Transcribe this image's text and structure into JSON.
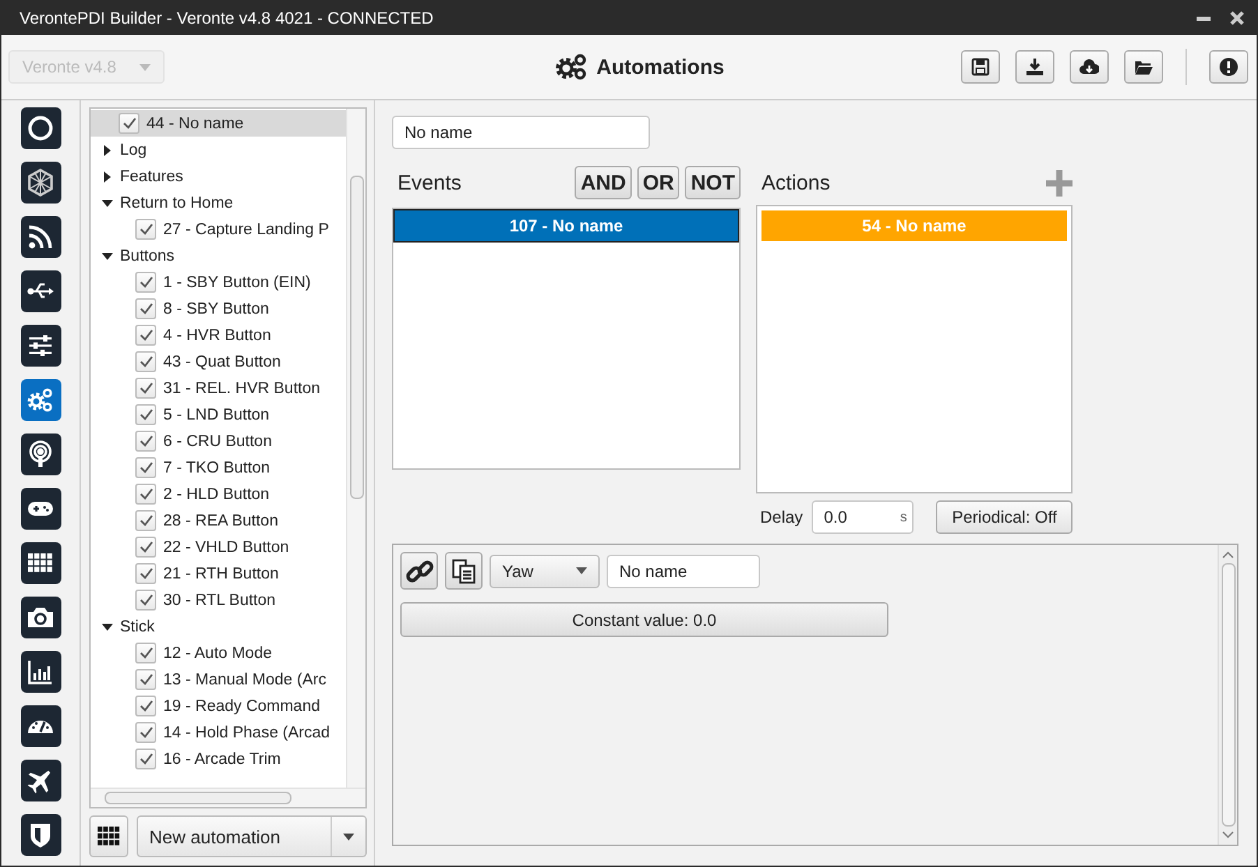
{
  "window": {
    "title": "VerontePDI Builder - Veronte v4.8 4021 - CONNECTED"
  },
  "toolbar": {
    "device": {
      "value": "Veronte v4.8",
      "disabled": true
    },
    "title": "Automations",
    "buttons": [
      {
        "kind": "save"
      },
      {
        "kind": "download"
      },
      {
        "kind": "cloud"
      },
      {
        "kind": "folder"
      },
      {
        "kind": "info"
      }
    ]
  },
  "sidebar": {
    "items": [
      {
        "kind": "ring",
        "selected": false
      },
      {
        "kind": "hex",
        "selected": false
      },
      {
        "kind": "rss",
        "selected": false
      },
      {
        "kind": "usb",
        "selected": false
      },
      {
        "kind": "sliders",
        "selected": false
      },
      {
        "kind": "gears",
        "selected": true
      },
      {
        "kind": "podcast",
        "selected": false
      },
      {
        "kind": "gamepad",
        "selected": false
      },
      {
        "kind": "grid",
        "selected": false
      },
      {
        "kind": "camera",
        "selected": false
      },
      {
        "kind": "chart",
        "selected": false
      },
      {
        "kind": "gauge",
        "selected": false
      },
      {
        "kind": "plane",
        "selected": false
      },
      {
        "kind": "shield",
        "selected": false
      }
    ]
  },
  "tree": {
    "items": [
      {
        "kind": "check",
        "label": "44 - No name",
        "checked": true,
        "selected": true
      },
      {
        "kind": "group",
        "label": "Log",
        "expanded": false
      },
      {
        "kind": "group",
        "label": "Features",
        "expanded": false
      },
      {
        "kind": "group",
        "label": "Return to Home",
        "expanded": true,
        "children": [
          {
            "kind": "check",
            "label": "27 - Capture Landing P",
            "checked": true,
            "selected": false
          }
        ]
      },
      {
        "kind": "group",
        "label": "Buttons",
        "expanded": true,
        "children": [
          {
            "kind": "check",
            "label": "1 - SBY Button (EIN)",
            "checked": true,
            "selected": false
          },
          {
            "kind": "check",
            "label": "8 - SBY Button",
            "checked": true,
            "selected": false
          },
          {
            "kind": "check",
            "label": "4 - HVR Button",
            "checked": true,
            "selected": false
          },
          {
            "kind": "check",
            "label": "43 - Quat Button",
            "checked": true,
            "selected": false
          },
          {
            "kind": "check",
            "label": "31 - REL. HVR Button",
            "checked": true,
            "selected": false
          },
          {
            "kind": "check",
            "label": "5 - LND Button",
            "checked": true,
            "selected": false
          },
          {
            "kind": "check",
            "label": "6 - CRU Button",
            "checked": true,
            "selected": false
          },
          {
            "kind": "check",
            "label": "7 - TKO Button",
            "checked": true,
            "selected": false
          },
          {
            "kind": "check",
            "label": "2 - HLD Button",
            "checked": true,
            "selected": false
          },
          {
            "kind": "check",
            "label": "28 - REA Button",
            "checked": true,
            "selected": false
          },
          {
            "kind": "check",
            "label": "22 - VHLD Button",
            "checked": true,
            "selected": false
          },
          {
            "kind": "check",
            "label": "21 - RTH Button",
            "checked": true,
            "selected": false
          },
          {
            "kind": "check",
            "label": "30 - RTL Button",
            "checked": true,
            "selected": false
          }
        ]
      },
      {
        "kind": "group",
        "label": "Stick",
        "expanded": true,
        "children": [
          {
            "kind": "check",
            "label": "12 - Auto Mode",
            "checked": true,
            "selected": false
          },
          {
            "kind": "check",
            "label": "13 - Manual Mode (Arc",
            "checked": true,
            "selected": false
          },
          {
            "kind": "check",
            "label": "19 - Ready Command",
            "checked": true,
            "selected": false
          },
          {
            "kind": "check",
            "label": "14 - Hold Phase (Arcad",
            "checked": true,
            "selected": false
          },
          {
            "kind": "check",
            "label": "16 - Arcade Trim",
            "checked": true,
            "selected": false
          }
        ]
      }
    ]
  },
  "tree_footer": {
    "combo": "New automation"
  },
  "editor": {
    "name": "No name",
    "events": {
      "label": "Events",
      "operators": [
        "AND",
        "OR",
        "NOT"
      ],
      "items": [
        {
          "label": "107 - No name",
          "color": "#0070b8"
        }
      ]
    },
    "actions": {
      "label": "Actions",
      "items": [
        {
          "label": "54 - No name",
          "color": "#ffa500"
        }
      ]
    },
    "delay": {
      "label": "Delay",
      "value": "0.0",
      "unit": "s"
    },
    "periodical": "Periodical: Off"
  },
  "detail": {
    "axis": "Yaw",
    "name": "No name",
    "constant": "Constant value: 0.0"
  }
}
